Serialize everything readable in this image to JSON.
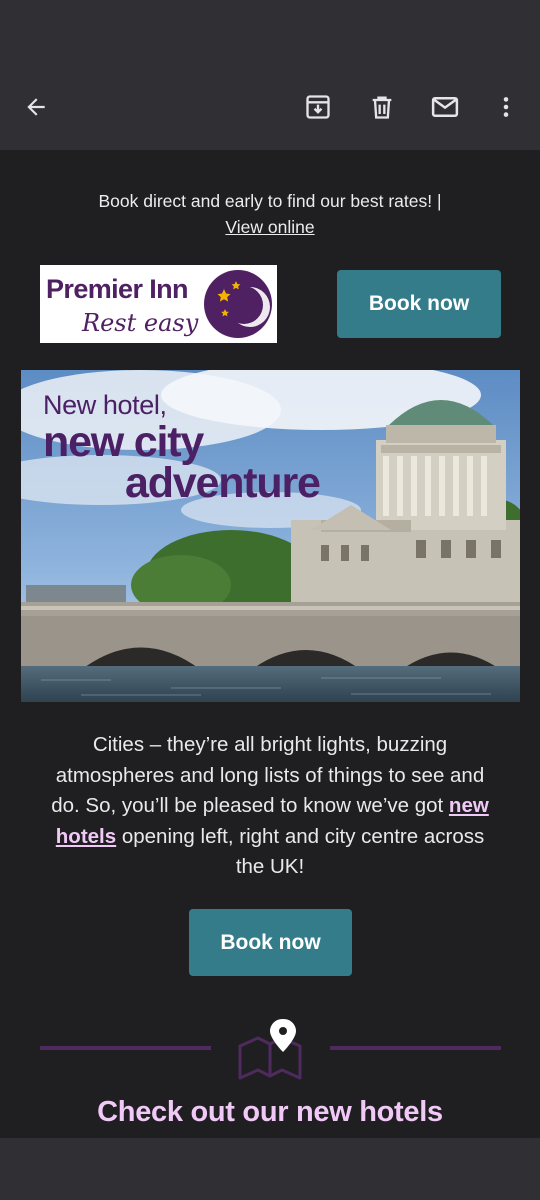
{
  "app_bar": {
    "icons": [
      "back-arrow-icon",
      "archive-icon",
      "delete-icon",
      "mark-unread-icon",
      "more-vert-icon"
    ]
  },
  "email": {
    "preheader": {
      "text": "Book direct and early to find our best rates!  |",
      "view_online": "View online"
    },
    "logo": {
      "brand": "Premier Inn",
      "tagline": "Rest easy"
    },
    "book_now_top": "Book now",
    "hero": {
      "line1": "New hotel,",
      "line2": "new city",
      "line3": "adventure"
    },
    "body": {
      "part1": "Cities – they’re all bright lights, buzzing atmospheres and long lists of things to see and do. So, you’ll be pleased to know we’ve got ",
      "link": "new hotels",
      "part2": " opening left, right and city centre across the UK!"
    },
    "book_now_main": "Book now",
    "section_title": "Check out our new hotels"
  },
  "colors": {
    "background": "#1f1e21",
    "app_bar": "#302f34",
    "button": "#357c8b",
    "brand_purple": "#4f2062",
    "pink_text": "#f1c9f7",
    "divider": "#4f2a5e"
  }
}
